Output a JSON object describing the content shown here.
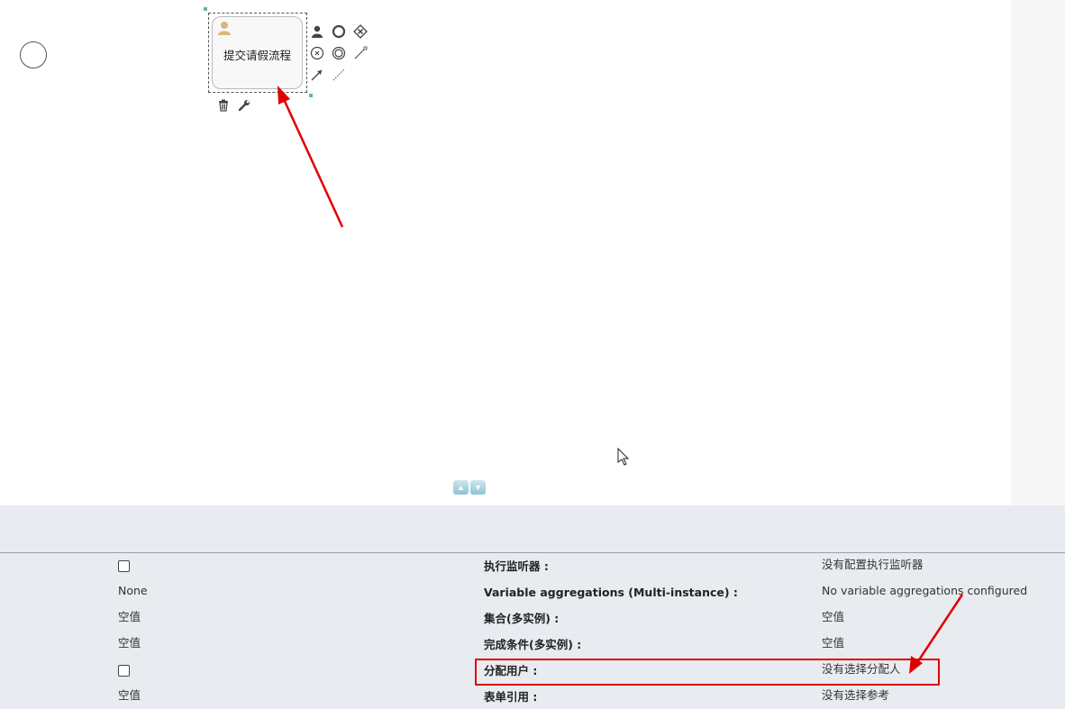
{
  "canvas": {
    "task": {
      "label": "提交请假流程",
      "icon": "user-icon"
    },
    "palette": [
      {
        "name": "user-task-icon",
        "glyph": "👤"
      },
      {
        "name": "end-event-icon",
        "glyph": ""
      },
      {
        "name": "gateway-icon",
        "glyph": "⊗"
      },
      {
        "name": "intermediate-event-icon",
        "glyph": ""
      },
      {
        "name": "boundary-event-icon",
        "glyph": ""
      },
      {
        "name": "association-icon",
        "glyph": ""
      },
      {
        "name": "sequence-flow-icon",
        "glyph": ""
      },
      {
        "name": "dotted-association-icon",
        "glyph": ""
      }
    ],
    "tools": [
      {
        "name": "delete-icon",
        "glyph": "🗑"
      },
      {
        "name": "wrench-icon",
        "glyph": "🔧"
      }
    ]
  },
  "properties": {
    "left_column": [
      {
        "type": "checkbox",
        "checked": false
      },
      {
        "type": "text",
        "value": "None"
      },
      {
        "type": "text",
        "value": "空值"
      },
      {
        "type": "text",
        "value": "空值"
      },
      {
        "type": "checkbox",
        "checked": false
      },
      {
        "type": "text",
        "value": "空值"
      }
    ],
    "rows": [
      {
        "label": "执行监听器 :",
        "value": "没有配置执行监听器"
      },
      {
        "label": "Variable aggregations (Multi-instance) :",
        "value": "No variable aggregations configured"
      },
      {
        "label": "集合(多实例) :",
        "value": "空值"
      },
      {
        "label": "完成条件(多实例) :",
        "value": "空值"
      },
      {
        "label": "分配用户 :",
        "value": "没有选择分配人"
      },
      {
        "label": "表单引用 :",
        "value": "没有选择参考"
      }
    ]
  },
  "annotations": {
    "highlight_color": "#e00000"
  }
}
